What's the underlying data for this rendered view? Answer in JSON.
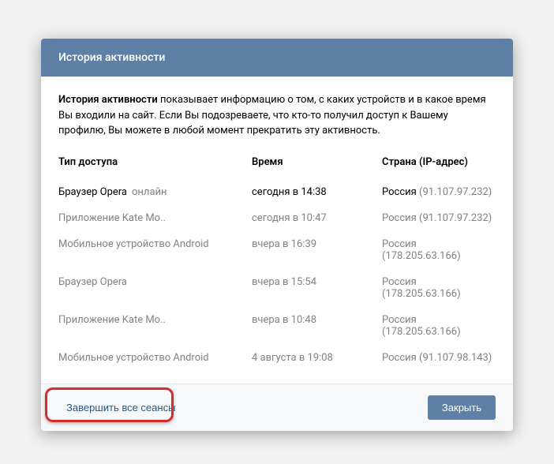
{
  "header": {
    "title": "История активности"
  },
  "description": {
    "bold": "История активности",
    "text": " показывает информацию о том, с каких устройств и в какое время Вы входили на сайт. Если Вы подозреваете, что кто-то получил доступ к Вашему профилю, Вы можете в любой момент прекратить эту активность."
  },
  "columns": {
    "type": "Тип доступа",
    "time": "Время",
    "country": "Страна (IP-адрес)"
  },
  "sessions": [
    {
      "type": "Браузер Opera",
      "online": "онлайн",
      "time": "сегодня в 14:38",
      "country": "Россия",
      "ip": "(91.107.97.232)",
      "active": true
    },
    {
      "type": "Приложение Kate Mo..",
      "online": "",
      "time": "сегодня в 10:47",
      "country": "Россия",
      "ip": "(91.107.97.232)",
      "active": false
    },
    {
      "type": "Мобильное устройство Android",
      "online": "",
      "time": "вчера в 16:39",
      "country": "Россия",
      "ip": "(178.205.63.166)",
      "active": false
    },
    {
      "type": "Браузер Opera",
      "online": "",
      "time": "вчера в 15:54",
      "country": "Россия",
      "ip": "(178.205.63.166)",
      "active": false
    },
    {
      "type": "Приложение Kate Mo..",
      "online": "",
      "time": "вчера в 10:48",
      "country": "Россия",
      "ip": "(178.205.63.166)",
      "active": false
    },
    {
      "type": "Мобильное устройство Android",
      "online": "",
      "time": "4 августа в 19:08",
      "country": "Россия",
      "ip": "(91.107.98.143)",
      "active": false
    }
  ],
  "footer": {
    "end_sessions": "Завершить все сеансы",
    "close": "Закрыть"
  }
}
